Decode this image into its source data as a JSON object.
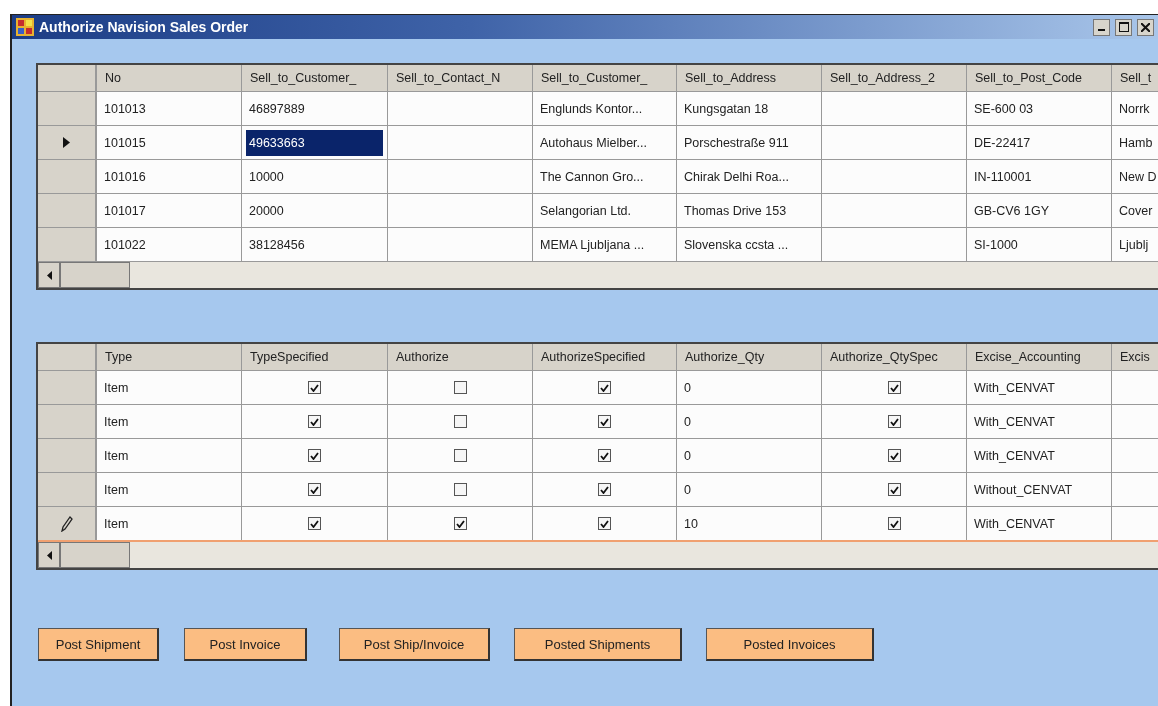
{
  "window": {
    "title": "Authorize Navision Sales Order"
  },
  "orders": {
    "columns": [
      {
        "label": "No"
      },
      {
        "label": "Sell_to_Customer_"
      },
      {
        "label": "Sell_to_Contact_N"
      },
      {
        "label": "Sell_to_Customer_"
      },
      {
        "label": "Sell_to_Address"
      },
      {
        "label": "Sell_to_Address_2"
      },
      {
        "label": "Sell_to_Post_Code"
      },
      {
        "label": "Sell_t"
      }
    ],
    "rows": [
      {
        "selected": false,
        "cells": [
          {
            "text": "101013",
            "selected": false
          },
          {
            "text": "46897889",
            "selected": false
          },
          {
            "selected": false
          },
          {
            "text": "Englunds Kontor...",
            "selected": false
          },
          {
            "text": "Kungsgatan 18",
            "selected": false
          },
          {
            "selected": false
          },
          {
            "text": "SE-600 03",
            "selected": false
          },
          {
            "text": "Norrk",
            "selected": false
          }
        ]
      },
      {
        "selected": true,
        "cells": [
          {
            "text": "101015",
            "selected": false
          },
          {
            "text": "49633663",
            "selected": true
          },
          {
            "selected": false
          },
          {
            "text": "Autohaus Mielber...",
            "selected": false
          },
          {
            "text": "Porschestraße 911",
            "selected": false
          },
          {
            "selected": false
          },
          {
            "text": "DE-22417",
            "selected": false
          },
          {
            "text": "Hamb",
            "selected": false
          }
        ]
      },
      {
        "selected": false,
        "cells": [
          {
            "text": "101016",
            "selected": false
          },
          {
            "text": "10000",
            "selected": false
          },
          {
            "selected": false
          },
          {
            "text": "The Cannon Gro...",
            "selected": false
          },
          {
            "text": "Chirak Delhi Roa...",
            "selected": false
          },
          {
            "selected": false
          },
          {
            "text": "IN-110001",
            "selected": false
          },
          {
            "text": "New D",
            "selected": false
          }
        ]
      },
      {
        "selected": false,
        "cells": [
          {
            "text": "101017",
            "selected": false
          },
          {
            "text": "20000",
            "selected": false
          },
          {
            "selected": false
          },
          {
            "text": "Selangorian Ltd.",
            "selected": false
          },
          {
            "text": "Thomas Drive 153",
            "selected": false
          },
          {
            "selected": false
          },
          {
            "text": "GB-CV6 1GY",
            "selected": false
          },
          {
            "text": "Cover",
            "selected": false
          }
        ]
      },
      {
        "selected": false,
        "cells": [
          {
            "text": "101022",
            "selected": false
          },
          {
            "text": "38128456",
            "selected": false
          },
          {
            "selected": false
          },
          {
            "text": "MEMA Ljubljana ...",
            "selected": false
          },
          {
            "text": "Slovenska ccsta ...",
            "selected": false
          },
          {
            "selected": false
          },
          {
            "text": "SI-1000",
            "selected": false
          },
          {
            "text": "Ljublj",
            "selected": false
          }
        ]
      }
    ]
  },
  "lines": {
    "columns": [
      {
        "label": "Type",
        "kind": "text"
      },
      {
        "label": "TypeSpecified",
        "kind": "check"
      },
      {
        "label": "Authorize",
        "kind": "check"
      },
      {
        "label": "AuthorizeSpecified",
        "kind": "check"
      },
      {
        "label": "Authorize_Qty",
        "kind": "text"
      },
      {
        "label": "Authorize_QtySpec",
        "kind": "check"
      },
      {
        "label": "Excise_Accounting",
        "kind": "text"
      },
      {
        "label": "Excis",
        "kind": "text"
      }
    ],
    "rows": [
      {
        "editing": false,
        "cells": [
          "Item",
          {
            "checked": true
          },
          {
            "checked": false
          },
          {
            "checked": true
          },
          "0",
          {
            "checked": true
          },
          "With_CENVAT",
          null
        ]
      },
      {
        "editing": false,
        "cells": [
          "Item",
          {
            "checked": true
          },
          {
            "checked": false
          },
          {
            "checked": true
          },
          "0",
          {
            "checked": true
          },
          "With_CENVAT",
          null
        ]
      },
      {
        "editing": false,
        "cells": [
          "Item",
          {
            "checked": true
          },
          {
            "checked": false
          },
          {
            "checked": true
          },
          "0",
          {
            "checked": true
          },
          "With_CENVAT",
          null
        ]
      },
      {
        "editing": false,
        "cells": [
          "Item",
          {
            "checked": true
          },
          {
            "checked": false
          },
          {
            "checked": true
          },
          "0",
          {
            "checked": true
          },
          "Without_CENVAT",
          null
        ]
      },
      {
        "editing": true,
        "cells": [
          "Item",
          {
            "checked": true
          },
          {
            "checked": true
          },
          {
            "checked": true
          },
          "10",
          {
            "checked": true
          },
          "With_CENVAT",
          null
        ]
      }
    ]
  },
  "buttons": [
    "Post Shipment",
    "Post Invoice",
    "Post Ship/Invoice",
    "Posted Shipments",
    "Posted Invoices"
  ]
}
